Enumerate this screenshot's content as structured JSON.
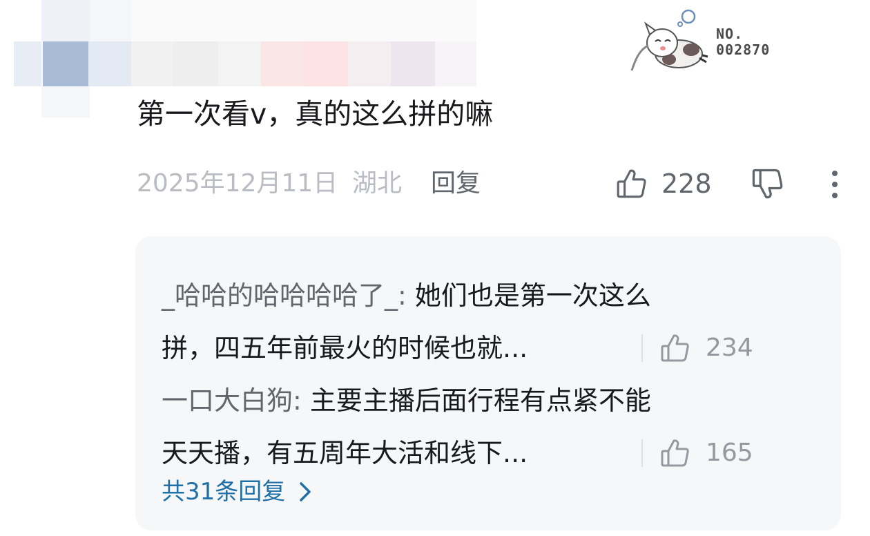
{
  "badge": {
    "icon": "cartoon-mascot-icon",
    "label_prefix": "NO.",
    "number": "002870"
  },
  "comment": {
    "text": "第一次看v，真的这么拼的嘛",
    "date": "2025年12月11日",
    "location": "湖北",
    "reply_label": "回复",
    "like_count": "228"
  },
  "replies": [
    {
      "author": "_哈哈的哈哈哈哈了_:",
      "text_line1": " 她们也是第一次这么",
      "text_line2": "拼，四五年前最火的时候也就...",
      "like_count": "234"
    },
    {
      "author": "一口大白狗:",
      "text_line1": " 主要主播后面行程有点紧不能",
      "text_line2": "天天播，有五周年大活和线下...",
      "like_count": "165"
    }
  ],
  "more_replies_label": "共31条回复",
  "colors": {
    "text_primary": "#18191c",
    "text_meta": "#b9bcc2",
    "text_secondary": "#61666d",
    "link_blue": "#1f6fa8",
    "reply_bg": "#f6f7f8"
  }
}
